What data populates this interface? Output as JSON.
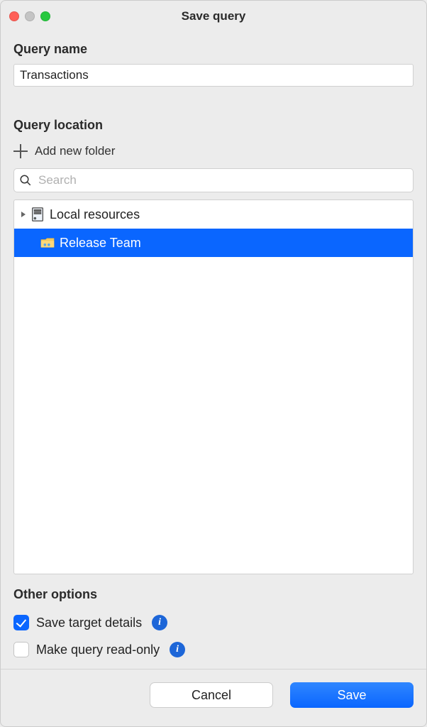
{
  "window": {
    "title": "Save query"
  },
  "queryName": {
    "label": "Query name",
    "value": "Transactions"
  },
  "queryLocation": {
    "label": "Query location",
    "addFolder": "Add new folder",
    "search": {
      "placeholder": "Search",
      "value": ""
    },
    "tree": {
      "root": {
        "label": "Local resources",
        "expanded": true
      },
      "items": [
        {
          "label": "Release Team",
          "icon": "folder-shared-icon",
          "selected": true
        }
      ]
    }
  },
  "otherOptions": {
    "label": "Other options",
    "saveTargetDetails": {
      "label": "Save target details",
      "checked": true
    },
    "readOnly": {
      "label": "Make query read-only",
      "checked": false
    }
  },
  "footer": {
    "cancel": "Cancel",
    "save": "Save"
  },
  "colors": {
    "accent": "#0a66ff"
  }
}
